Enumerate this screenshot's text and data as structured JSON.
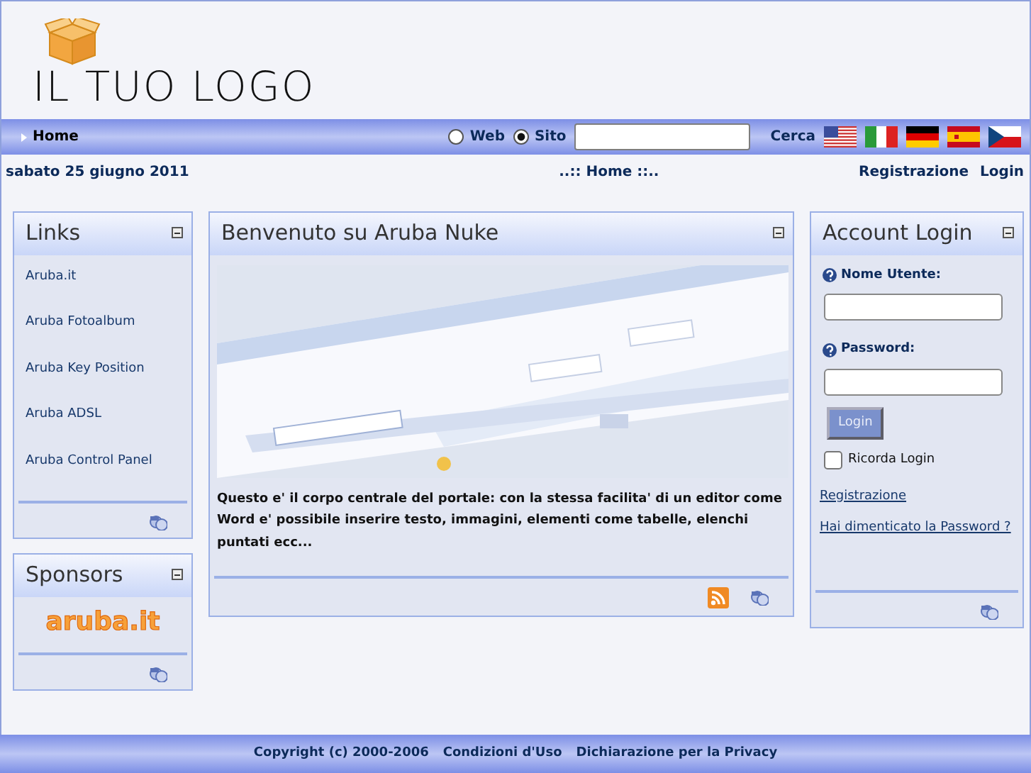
{
  "logo": {
    "text": "IL TUO LOGO"
  },
  "navbar": {
    "home": "Home",
    "search_scopes": [
      {
        "label": "Web",
        "selected": false
      },
      {
        "label": "Sito",
        "selected": true
      }
    ],
    "search_button": "Cerca",
    "languages": [
      {
        "kind": "us"
      },
      {
        "kind": "it"
      },
      {
        "kind": "de"
      },
      {
        "kind": "es"
      },
      {
        "kind": "cz"
      }
    ]
  },
  "info_bar": {
    "date": "sabato 25 giugno 2011",
    "breadcrumb": "..:: Home ::..",
    "links": [
      "Registrazione",
      "Login"
    ]
  },
  "links_block": {
    "title": "Links",
    "items": [
      "Aruba.it",
      "Aruba Fotoalbum",
      "Aruba Key Position",
      "Aruba ADSL",
      "Aruba Control Panel"
    ]
  },
  "sponsors_block": {
    "title": "Sponsors",
    "logo": "aruba.it"
  },
  "main_block": {
    "title": "Benvenuto su Aruba Nuke",
    "text": "Questo e' il corpo centrale del portale: con la stessa facilita' di un editor come Word e' possibile inserire testo, immagini, elementi come tabelle, elenchi puntati ecc..."
  },
  "login_block": {
    "title": "Account Login",
    "username_label": "Nome Utente:",
    "password_label": "Password:",
    "login_button": "Login",
    "remember": {
      "label": "Ricorda Login",
      "checked": false
    },
    "links": [
      "Registrazione",
      "Hai dimenticato la Password ?"
    ]
  },
  "footer": {
    "items": [
      "Copyright (c) 2000-2006",
      "Condizioni d'Uso",
      "Dichiarazione per la Privacy"
    ]
  }
}
